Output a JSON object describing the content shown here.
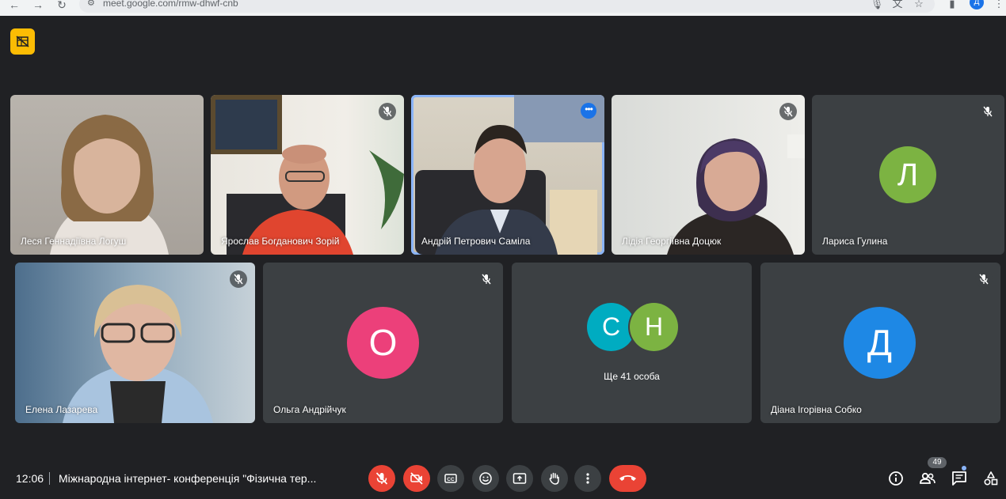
{
  "browser": {
    "url": "meet.google.com/rmw-dhwf-cnb",
    "profile_initial": "Д"
  },
  "tiles": [
    {
      "name": "Леся Геннадіївна Логуш",
      "muted": false,
      "video": true
    },
    {
      "name": "Ярослав Богданович Зорій",
      "muted": true,
      "video": true
    },
    {
      "name": "Андрій Петрович Саміла",
      "muted": false,
      "video": true,
      "speaking": true
    },
    {
      "name": "Лідія Георгіївна Доцюк",
      "muted": true,
      "video": true
    },
    {
      "name": "Лариса Гулина",
      "muted": true,
      "video": false,
      "initial": "Л",
      "avatar_color": "#7cb342"
    },
    {
      "name": "Елена Лазарева",
      "muted": true,
      "video": true
    },
    {
      "name": "Ольга Андрійчук",
      "muted": true,
      "video": false,
      "initial": "О",
      "avatar_color": "#ec407a"
    },
    {
      "name": "Ще 41 особа",
      "video": false,
      "initials": [
        "С",
        "Н"
      ],
      "avatar_colors": [
        "#00acc1",
        "#7cb342"
      ]
    },
    {
      "name": "Діана Ігорівна Собко",
      "muted": true,
      "video": false,
      "initial": "Д",
      "avatar_color": "#1e88e5"
    }
  ],
  "bottom": {
    "time": "12:06",
    "meeting_title": "Міжнародна інтернет- конференція \"Фізична тер...",
    "participant_count": "49"
  },
  "colors": {
    "background": "#202124",
    "tile": "#3c4043",
    "accent_red": "#ea4335",
    "speaking_outline": "#8ab4f8",
    "warning": "#fbbc04"
  }
}
